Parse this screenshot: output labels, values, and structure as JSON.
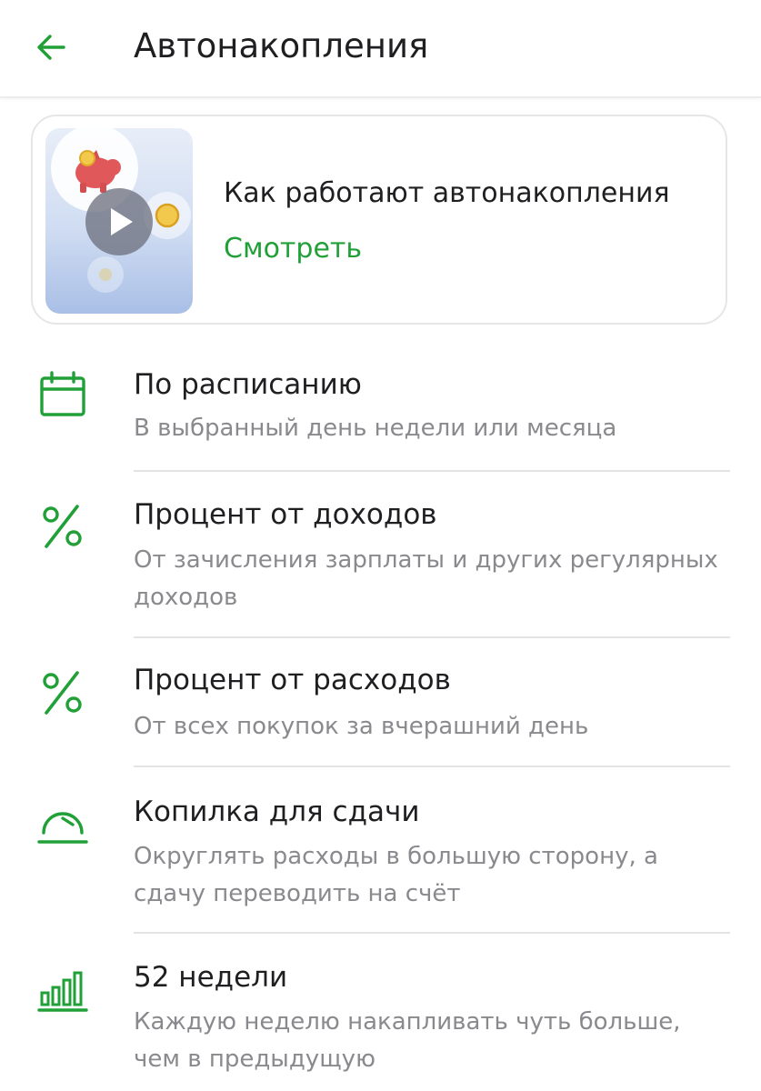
{
  "header": {
    "title": "Автонакопления"
  },
  "video_card": {
    "title": "Как работают автонакопления",
    "link": "Смотреть"
  },
  "items": [
    {
      "title": "По расписанию",
      "subtitle": "В выбранный день недели или месяца",
      "icon": "calendar-icon"
    },
    {
      "title": "Процент от доходов",
      "subtitle": "От зачисления зарплаты и других регулярных доходов",
      "icon": "percent-icon"
    },
    {
      "title": "Процент от расходов",
      "subtitle": "От всех покупок за вчерашний день",
      "icon": "percent-icon"
    },
    {
      "title": "Копилка для сдачи",
      "subtitle": "Округлять расходы в большую сторону, а сдачу переводить на счёт",
      "icon": "piggy-gauge-icon"
    },
    {
      "title": "52 недели",
      "subtitle": "Каждую неделю накапливать чуть больше, чем в предыдущую",
      "icon": "bar-chart-icon"
    }
  ],
  "colors": {
    "accent": "#21a038",
    "text": "#1f1f22",
    "secondary_text": "#8a8a8e",
    "divider": "#e3e3e3"
  }
}
